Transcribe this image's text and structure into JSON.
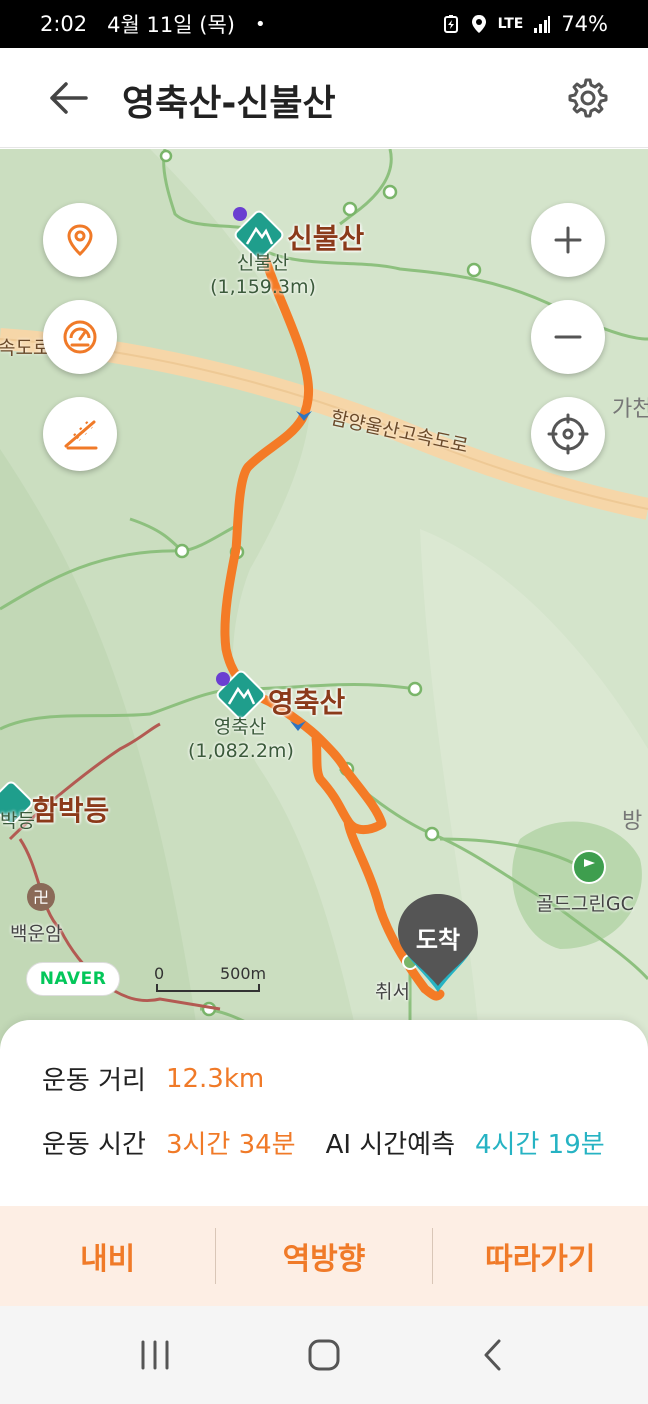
{
  "status_bar": {
    "time": "2:02",
    "date": "4월 11일 (목)",
    "dot": "•",
    "network": "LTE",
    "battery": "74%"
  },
  "header": {
    "title": "영축산-신불산",
    "back_icon": "arrow-left-icon",
    "settings_icon": "gear-icon"
  },
  "map": {
    "labels": {
      "peak1_name": "신불산",
      "peak1_sub": "신불산",
      "peak1_elev": "(1,159.3m)",
      "peak2_name": "영축산",
      "peak2_sub": "영축산",
      "peak2_elev": "(1,082.2m)",
      "peak3_name": "함박등",
      "peak3_sub": "박등",
      "highway": "함양울산고속도로",
      "highway_left": "속도로",
      "temple": "백운암",
      "golf": "골드그린GC",
      "start_point": "취서",
      "edge_ga": "가천",
      "edge_bang": "방"
    },
    "scale_zero": "0",
    "scale_distance": "500m",
    "provider_logo": "NAVER",
    "arrival_label": "도착",
    "route_color": "#f47b26",
    "controls": {
      "location_pin_icon": "location-pin-icon",
      "speedometer_icon": "speedometer-icon",
      "slope_icon": "slope-icon",
      "zoom_in_icon": "plus-icon",
      "zoom_out_icon": "minus-icon",
      "recenter_icon": "crosshair-icon"
    }
  },
  "info": {
    "distance_label": "운동 거리",
    "distance_value": "12.3km",
    "time_label": "운동 시간",
    "time_value": "3시간 34분",
    "ai_label": "AI 시간예측",
    "ai_value": "4시간 19분"
  },
  "actions": {
    "navigation": "내비",
    "reverse": "역방향",
    "follow": "따라가기"
  },
  "nav_bar": {
    "recents_icon": "recents-icon",
    "home_icon": "home-icon",
    "back_icon": "back-chevron-icon"
  },
  "colors": {
    "accent": "#f07a28",
    "teal": "#26b3c3",
    "map_green": "#d3e3c9",
    "peak_marker": "#1f9e8c"
  }
}
